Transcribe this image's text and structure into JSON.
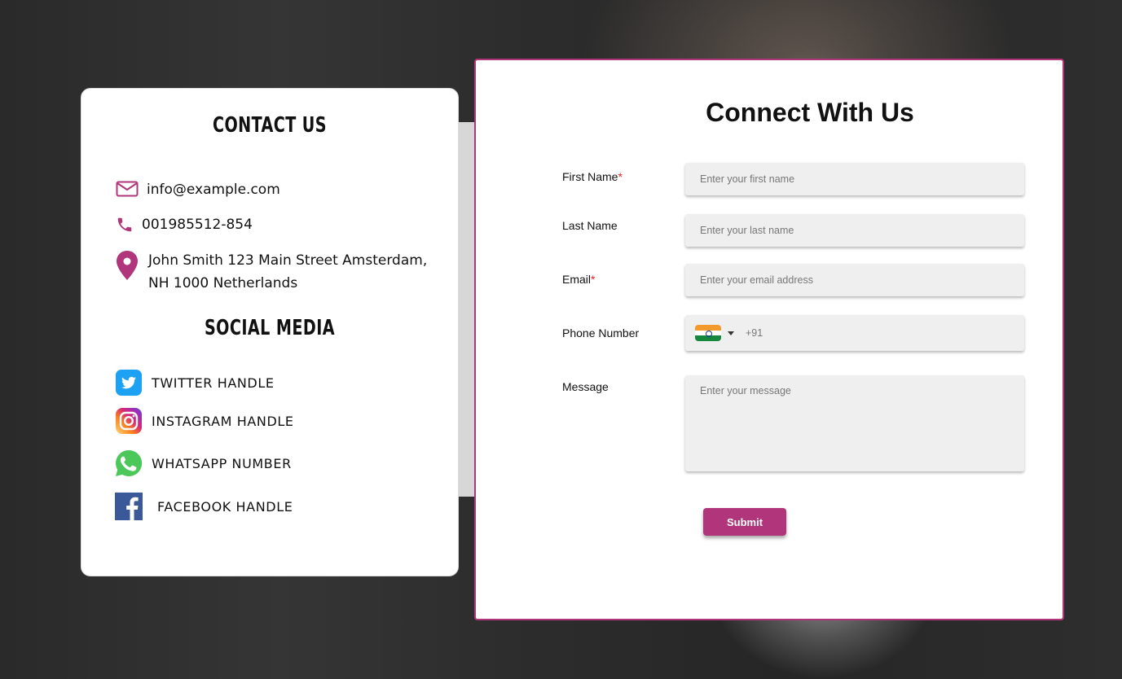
{
  "contact": {
    "heading": "CONTACT US",
    "email": "info@example.com",
    "phone": "001985512-854",
    "address_line1": "John Smith 123 Main Street Amsterdam,",
    "address_line2": "NH 1000 Netherlands",
    "icons": [
      "mail-icon",
      "phone-icon",
      "location-pin-icon"
    ]
  },
  "social": {
    "heading": "SOCIAL MEDIA",
    "items": [
      {
        "label": "TWITTER HANDLE",
        "icon": "twitter-icon"
      },
      {
        "label": "INSTAGRAM HANDLE",
        "icon": "instagram-icon"
      },
      {
        "label": "WHATSAPP NUMBER",
        "icon": "whatsapp-icon"
      },
      {
        "label": "FACEBOOK HANDLE",
        "icon": "facebook-icon"
      }
    ]
  },
  "form": {
    "title": "Connect With Us",
    "first_name_label": "First Name",
    "first_name_placeholder": "Enter your first name",
    "last_name_label": "Last Name",
    "last_name_placeholder": "Enter your last name",
    "email_label": "Email",
    "email_placeholder": "Enter your email address",
    "phone_label": "Phone Number",
    "phone_code": "+91",
    "phone_flag": "india-flag-icon",
    "message_label": "Message",
    "message_placeholder": "Enter your message",
    "required_marker": "*",
    "submit_label": "Submit"
  },
  "colors": {
    "accent": "#b0357a",
    "required": "#e02020",
    "field_bg": "#efefef"
  }
}
